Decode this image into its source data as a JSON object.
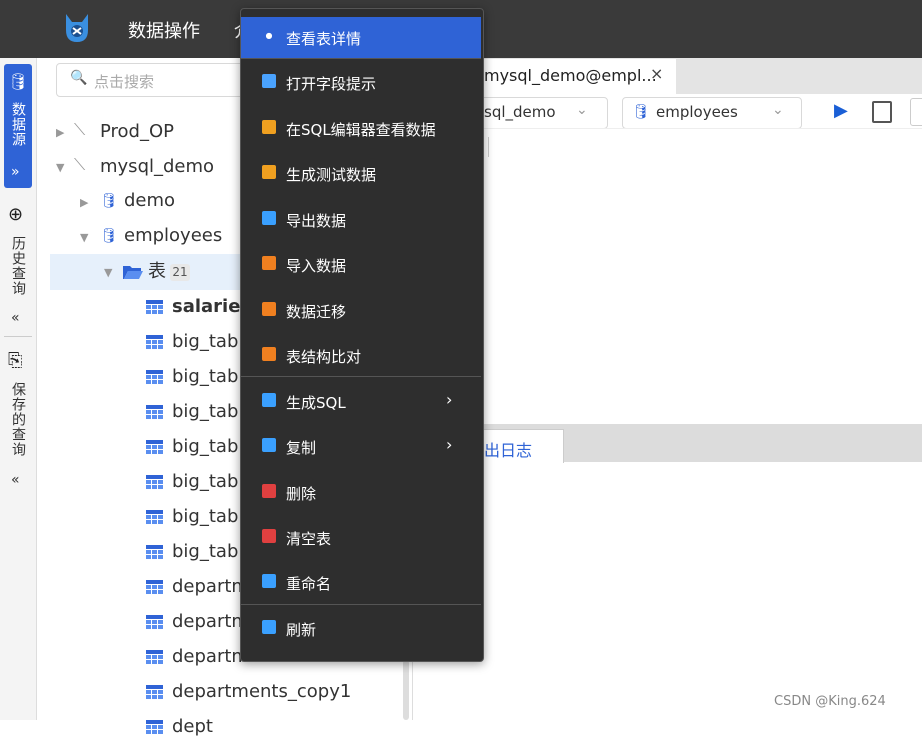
{
  "topbar": {
    "menu_label": "数据操作",
    "menu2_label": "介"
  },
  "sidebar": {
    "datasource_label": "数据源",
    "datasource_arrow": "»",
    "history_label": "历史查询",
    "history_arrow": "«",
    "saved_label": "保存的查询",
    "saved_arrow": "«"
  },
  "search": {
    "placeholder": "点击搜索"
  },
  "tree": {
    "conn1": "Prod_OP",
    "conn2": "mysql_demo",
    "db1": "demo",
    "db2": "employees",
    "folder": "表",
    "folder_count": "21",
    "tables": [
      "salaries",
      "big_tabl",
      "big_tabl",
      "big_tabl",
      "big_tabl",
      "big_tabl",
      "big_tabl",
      "big_tabl",
      "departm",
      "departm",
      "departm",
      "departments_copy1",
      "dept"
    ]
  },
  "editor": {
    "tab_label": "mysql_demo@empl...",
    "tab_close": "×",
    "conn_select": "sql_demo",
    "db_select": "employees",
    "log_tab": "出日志"
  },
  "context_menu": {
    "items": [
      {
        "label": "查看表详情",
        "icon": "eye-icon",
        "color": "#ffffff"
      },
      {
        "label": "打开字段提示",
        "icon": "field-hint-icon",
        "color": "#4aa3ff"
      },
      {
        "label": "在SQL编辑器查看数据",
        "icon": "sql-view-icon",
        "color": "#f0a020"
      },
      {
        "label": "生成测试数据",
        "icon": "chart-icon",
        "color": "#f0a020"
      },
      {
        "label": "导出数据",
        "icon": "export-icon",
        "color": "#3aa0ff"
      },
      {
        "label": "导入数据",
        "icon": "import-icon",
        "color": "#f08020"
      },
      {
        "label": "数据迁移",
        "icon": "migrate-icon",
        "color": "#f08020"
      },
      {
        "label": "表结构比对",
        "icon": "compare-icon",
        "color": "#f08020"
      },
      {
        "label": "生成SQL",
        "icon": "sql-icon",
        "color": "#3aa0ff"
      },
      {
        "label": "复制",
        "icon": "copy-icon",
        "color": "#3aa0ff"
      },
      {
        "label": "删除",
        "icon": "delete-icon",
        "color": "#e04040"
      },
      {
        "label": "清空表",
        "icon": "clear-icon",
        "color": "#e04040"
      },
      {
        "label": "重命名",
        "icon": "rename-icon",
        "color": "#3aa0ff"
      },
      {
        "label": "刷新",
        "icon": "refresh-icon",
        "color": "#3aa0ff"
      }
    ],
    "submenu_arrow": "›"
  },
  "watermark": "CSDN @King.624",
  "colors": {
    "accent": "#2f63d6",
    "menu_bg": "#2e2e2e",
    "topbar_bg": "#3a3a3a"
  }
}
